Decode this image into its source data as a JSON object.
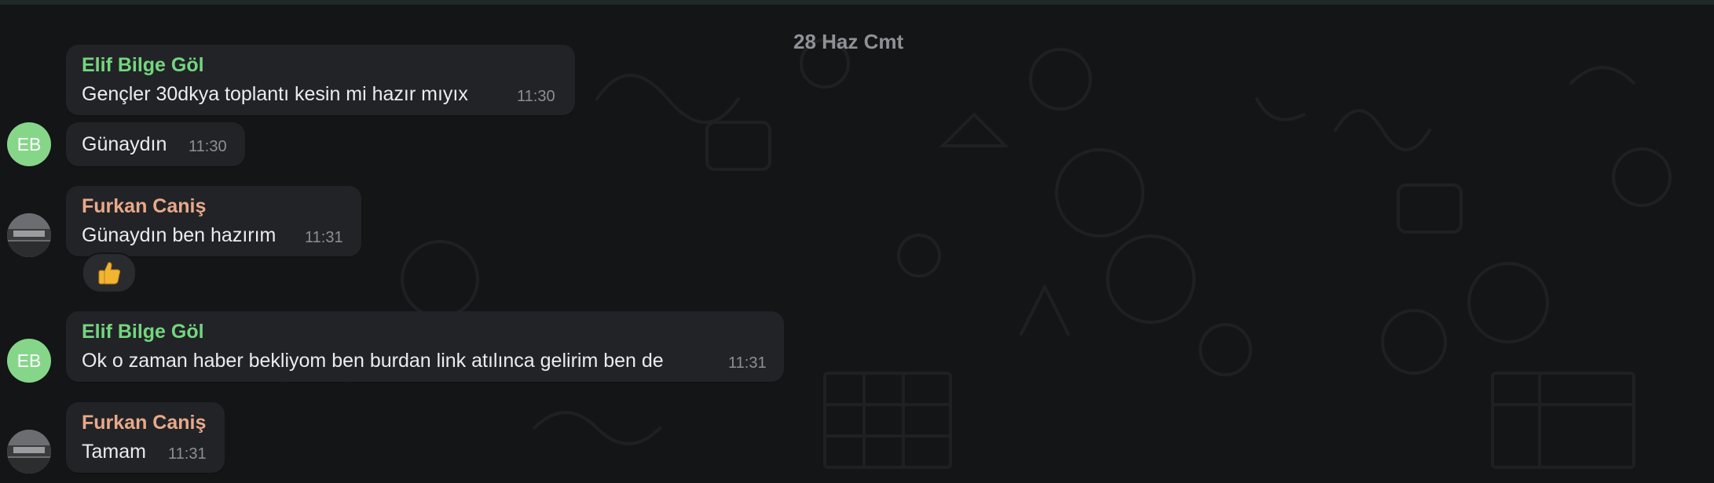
{
  "date_separator": "28 Haz Cmt",
  "messages": [
    {
      "sender": "Elif Bilge Göl",
      "text": "Gençler 30dkya toplantı kesin mi hazır mıyıx",
      "time": "11:30"
    },
    {
      "sender": "",
      "text": "Günaydın",
      "time": "11:30",
      "avatar_initials": "EB"
    },
    {
      "sender": "Furkan Caniş",
      "text": "Günaydın ben hazırım",
      "time": "11:31",
      "reaction": "thumbs-up"
    },
    {
      "sender": "Elif Bilge Göl",
      "text": "Ok o zaman haber bekliyom ben burdan link atılınca gelirim ben de",
      "time": "11:31",
      "avatar_initials": "EB"
    },
    {
      "sender": "Furkan Caniş",
      "text": "Tamam",
      "time": "11:31"
    }
  ],
  "colors": {
    "background": "#141517",
    "bubble": "#222326",
    "sender_elif": "#74d680",
    "sender_furkan": "#e8a98a",
    "avatar_elif": "#86d68a"
  }
}
